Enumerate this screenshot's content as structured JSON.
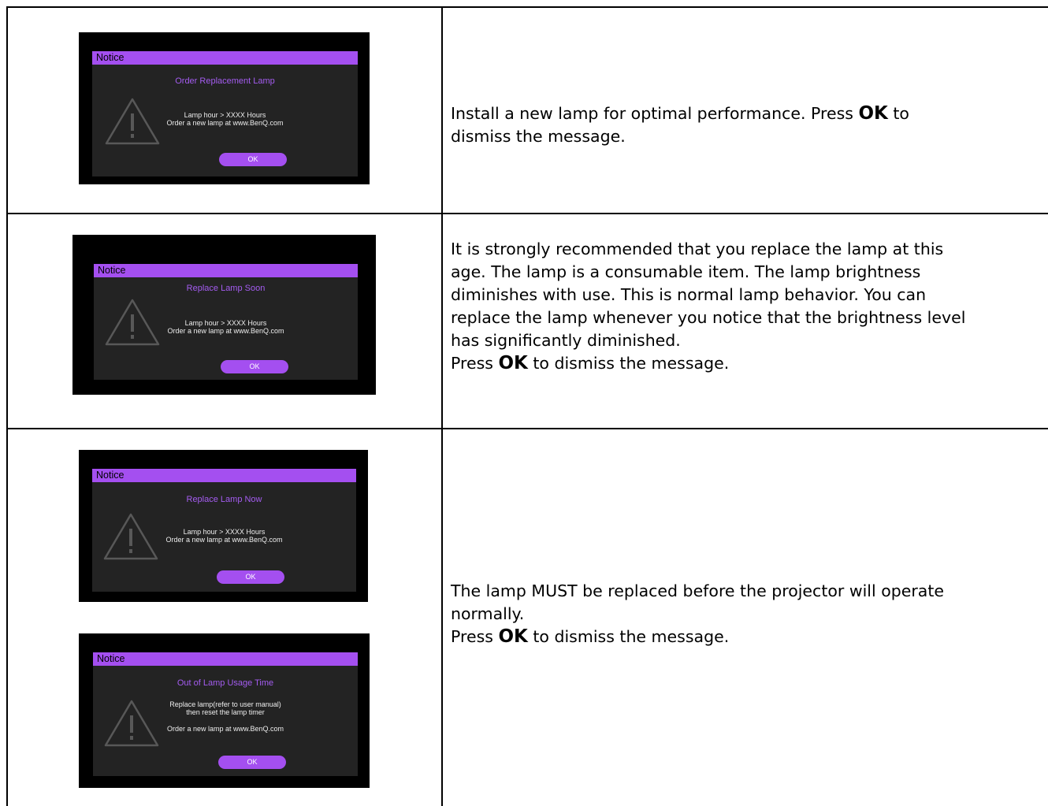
{
  "rows": [
    {
      "dialogs": [
        {
          "title": "Notice",
          "subtitle": "Order Replacement Lamp",
          "body_lines": [
            "Lamp hour > XXXX Hours",
            "Order a new lamp at www.BenQ.com"
          ],
          "ok_label": "OK"
        }
      ],
      "description": {
        "line1_pre": "Install a new lamp for optimal performance. Press ",
        "ok": "OK",
        "line1_post": " to",
        "line2": "dismiss the message."
      }
    },
    {
      "dialogs": [
        {
          "title": "Notice",
          "subtitle": "Replace Lamp Soon",
          "body_lines": [
            "Lamp hour > XXXX Hours",
            "Order a new lamp at www.BenQ.com"
          ],
          "ok_label": "OK"
        }
      ],
      "description": {
        "lines": [
          "It is strongly recommended that you replace the lamp at this",
          "age. The lamp is a consumable item. The lamp brightness",
          "diminishes with use. This is normal lamp behavior. You can",
          "replace the lamp whenever you notice that the brightness level",
          "has significantly diminished."
        ],
        "press_pre": "Press ",
        "ok": "OK",
        "press_post": " to dismiss the message."
      }
    },
    {
      "dialogs": [
        {
          "title": "Notice",
          "subtitle": "Replace Lamp Now",
          "body_lines": [
            "Lamp hour > XXXX Hours",
            "Order a new lamp at www.BenQ.com"
          ],
          "ok_label": "OK"
        },
        {
          "title": "Notice",
          "subtitle": "Out of Lamp Usage Time",
          "body_lines": [
            "Replace lamp(refer to user manual)",
            "then reset the lamp timer",
            "Order a new lamp at www.BenQ.com"
          ],
          "ok_label": "OK"
        }
      ],
      "description": {
        "lines": [
          "The lamp MUST be replaced before the projector will operate",
          "normally."
        ],
        "press_pre": "Press ",
        "ok": "OK",
        "press_post": " to dismiss the message."
      }
    }
  ],
  "colors": {
    "accent": "#a44ff0",
    "dialog_bg": "#232323",
    "screen_bg": "#000000"
  },
  "icons": [
    "warning-triangle-icon"
  ]
}
